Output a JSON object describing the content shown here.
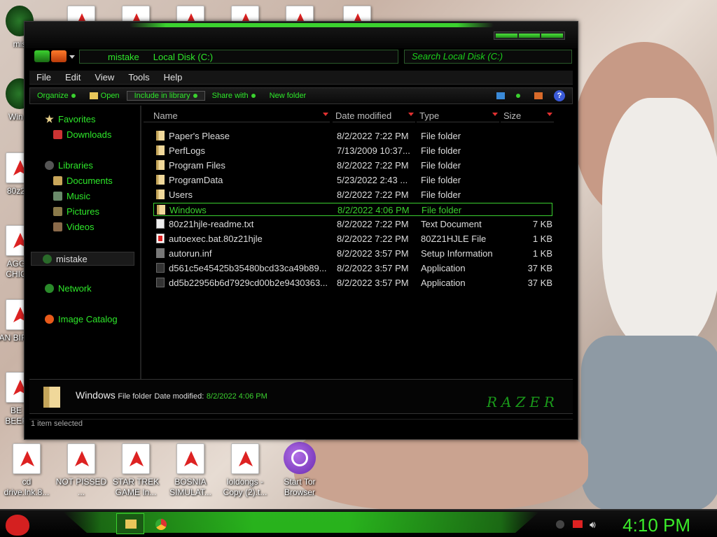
{
  "desktop_icons": [
    {
      "label": "mis",
      "kind": "green-orb"
    },
    {
      "label": "Win V",
      "kind": "green-orb"
    },
    {
      "label": "80z2",
      "kind": "doc"
    },
    {
      "label": "AGG CHIC",
      "kind": "pdf"
    },
    {
      "label": "AN BIRD",
      "kind": "pdf"
    },
    {
      "label": "BE BEEF",
      "kind": "pdf"
    },
    {
      "label": "cd drive.lnk.8...",
      "kind": "pdf"
    },
    {
      "label": "NOT PISSED ...",
      "kind": "pdf"
    },
    {
      "label": "STAR TREK GAME In...",
      "kind": "pdf"
    },
    {
      "label": "BOSNIA SIMULAT...",
      "kind": "pdf"
    },
    {
      "label": "loldongs - Copy (2).t...",
      "kind": "pdf"
    },
    {
      "label": "Start Tor Browser",
      "kind": "tor"
    }
  ],
  "address": {
    "crumb1": "mistake",
    "crumb2": "Local Disk (C:)"
  },
  "search": {
    "placeholder": "Search Local Disk (C:)"
  },
  "menu": [
    "File",
    "Edit",
    "View",
    "Tools",
    "Help"
  ],
  "toolbar": {
    "organize": "Organize",
    "open": "Open",
    "include": "Include in library",
    "share": "Share with",
    "new_folder": "New folder"
  },
  "nav": {
    "favorites": "Favorites",
    "downloads": "Downloads",
    "libraries": "Libraries",
    "documents": "Documents",
    "music": "Music",
    "pictures": "Pictures",
    "videos": "Videos",
    "computer": "mistake",
    "network": "Network",
    "image_catalog": "Image Catalog"
  },
  "columns": {
    "name": "Name",
    "date": "Date modified",
    "type": "Type",
    "size": "Size"
  },
  "files": [
    {
      "name": "Paper's Please",
      "date": "8/2/2022 7:22 PM",
      "type": "File folder",
      "size": "",
      "icon": "folder"
    },
    {
      "name": "PerfLogs",
      "date": "7/13/2009 10:37...",
      "type": "File folder",
      "size": "",
      "icon": "folder"
    },
    {
      "name": "Program Files",
      "date": "8/2/2022 7:22 PM",
      "type": "File folder",
      "size": "",
      "icon": "folder"
    },
    {
      "name": "ProgramData",
      "date": "5/23/2022 2:43 ...",
      "type": "File folder",
      "size": "",
      "icon": "folder"
    },
    {
      "name": "Users",
      "date": "8/2/2022 7:22 PM",
      "type": "File folder",
      "size": "",
      "icon": "folder"
    },
    {
      "name": "Windows",
      "date": "8/2/2022 4:06 PM",
      "type": "File folder",
      "size": "",
      "icon": "folder",
      "selected": true
    },
    {
      "name": "80z21hjle-readme.txt",
      "date": "8/2/2022 7:22 PM",
      "type": "Text Document",
      "size": "7 KB",
      "icon": "txt"
    },
    {
      "name": "autoexec.bat.80z21hjle",
      "date": "8/2/2022 7:22 PM",
      "type": "80Z21HJLE File",
      "size": "1 KB",
      "icon": "bat"
    },
    {
      "name": "autorun.inf",
      "date": "8/2/2022 3:57 PM",
      "type": "Setup Information",
      "size": "1 KB",
      "icon": "inf"
    },
    {
      "name": "d561c5e45425b35480bcd33ca49b89...",
      "date": "8/2/2022 3:57 PM",
      "type": "Application",
      "size": "37 KB",
      "icon": "exe"
    },
    {
      "name": "dd5b22956b6d7929cd00b2e9430363...",
      "date": "8/2/2022 3:57 PM",
      "type": "Application",
      "size": "37 KB",
      "icon": "exe"
    }
  ],
  "details": {
    "name": "Windows",
    "type": "File folder",
    "date_label": "Date modified:",
    "date": "8/2/2022 4:06 PM",
    "brand": "RAZER"
  },
  "status": "1 item selected",
  "clock": "4:10 PM",
  "colors": {
    "accent": "#3bd12f",
    "window_bg": "#000000"
  }
}
